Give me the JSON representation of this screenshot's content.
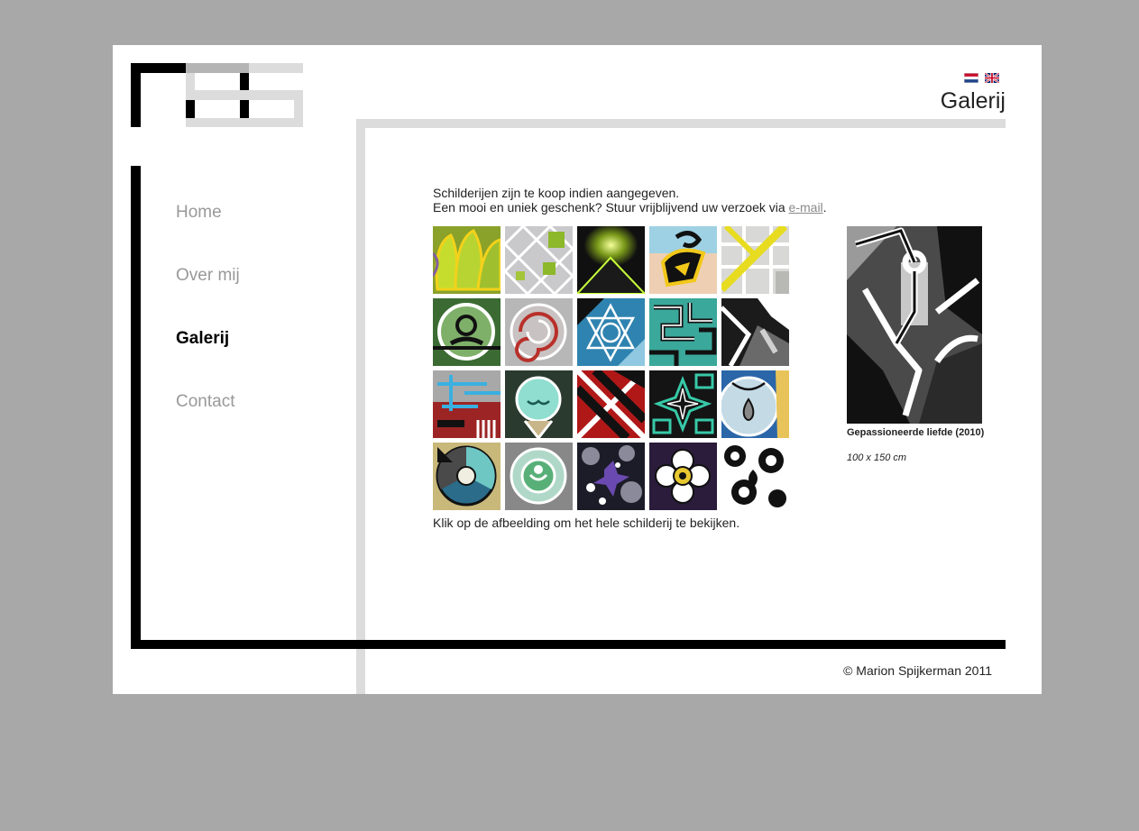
{
  "page": {
    "title": "Galerij"
  },
  "languages": [
    {
      "name": "Nederlands",
      "icon": "flag-nl-icon"
    },
    {
      "name": "English",
      "icon": "flag-en-icon"
    }
  ],
  "logo": {
    "letters": "MS",
    "icon": "ms-logo-icon"
  },
  "nav": {
    "items": [
      {
        "label": "Home",
        "active": false
      },
      {
        "label": "Over mij",
        "active": false
      },
      {
        "label": "Galerij",
        "active": true
      },
      {
        "label": "Contact",
        "active": false
      }
    ]
  },
  "intro": {
    "line1": "Schilderijen zijn te koop indien aangegeven.",
    "line2_before": "Een mooi en uniek geschenk? Stuur vrijblijvend uw verzoek via ",
    "line2_link": "e-mail",
    "line2_after": "."
  },
  "gallery": {
    "rows": 4,
    "cols": 5,
    "thumbnail_count": 20,
    "hint": "Klik op de afbeelding om het hele schilderij te bekijken."
  },
  "featured": {
    "title": "Gepassioneerde liefde (2010)",
    "size": "100 x 150 cm"
  },
  "footer": {
    "copyright": "© Marion Spijkerman 2011"
  },
  "colors": {
    "background": "#a8a8a8",
    "page": "#ffffff",
    "frame_black": "#000000",
    "frame_grey": "#dcdcdc",
    "nav_inactive": "#999999",
    "link": "#888888"
  }
}
